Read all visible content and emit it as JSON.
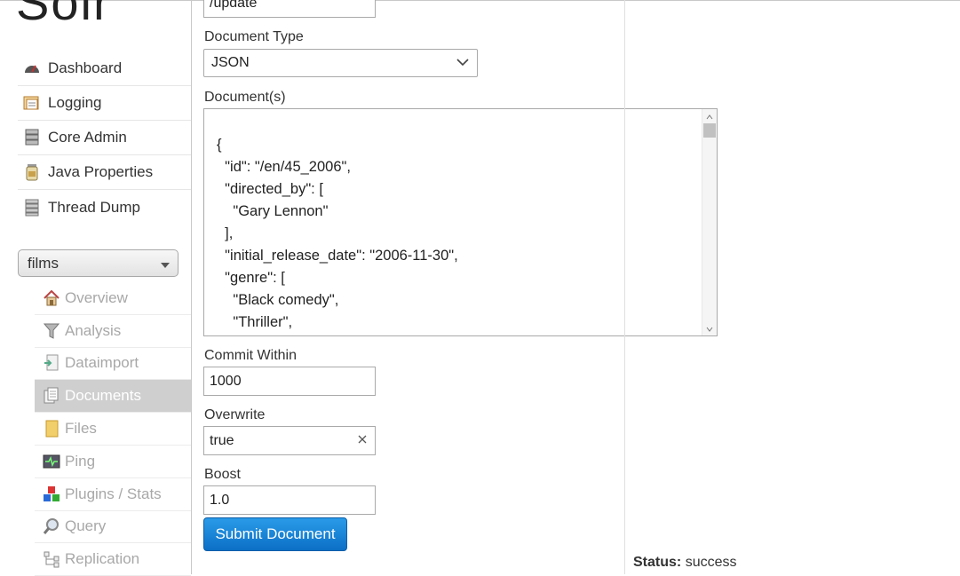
{
  "logo": {
    "text": "Solr"
  },
  "main_nav": [
    {
      "label": "Dashboard",
      "icon": "dashboard-icon"
    },
    {
      "label": "Logging",
      "icon": "logging-icon"
    },
    {
      "label": "Core Admin",
      "icon": "core-admin-icon"
    },
    {
      "label": "Java Properties",
      "icon": "java-properties-icon"
    },
    {
      "label": "Thread Dump",
      "icon": "thread-dump-icon"
    }
  ],
  "core_selector": {
    "value": "films"
  },
  "core_nav": [
    {
      "label": "Overview",
      "icon": "overview-icon"
    },
    {
      "label": "Analysis",
      "icon": "analysis-icon"
    },
    {
      "label": "Dataimport",
      "icon": "dataimport-icon"
    },
    {
      "label": "Documents",
      "icon": "documents-icon",
      "active": true
    },
    {
      "label": "Files",
      "icon": "files-icon"
    },
    {
      "label": "Ping",
      "icon": "ping-icon"
    },
    {
      "label": "Plugins / Stats",
      "icon": "plugins-icon"
    },
    {
      "label": "Query",
      "icon": "query-icon"
    },
    {
      "label": "Replication",
      "icon": "replication-icon"
    }
  ],
  "form": {
    "request_handler": {
      "value": "/update"
    },
    "document_type": {
      "label": "Document Type",
      "value": "JSON"
    },
    "documents": {
      "label": "Document(s)",
      "value": "{\n  \"id\": \"/en/45_2006\",\n  \"directed_by\": [\n    \"Gary Lennon\"\n  ],\n  \"initial_release_date\": \"2006-11-30\",\n  \"genre\": [\n    \"Black comedy\",\n    \"Thriller\","
    },
    "commit_within": {
      "label": "Commit Within",
      "value": "1000"
    },
    "overwrite": {
      "label": "Overwrite",
      "value": "true"
    },
    "boost": {
      "label": "Boost",
      "value": "1.0"
    },
    "submit_label": "Submit Document"
  },
  "status": {
    "label": "Status:",
    "value": "success"
  },
  "colors": {
    "accent": "#1a84d6",
    "active_nav_bg": "#cfcfcf"
  }
}
